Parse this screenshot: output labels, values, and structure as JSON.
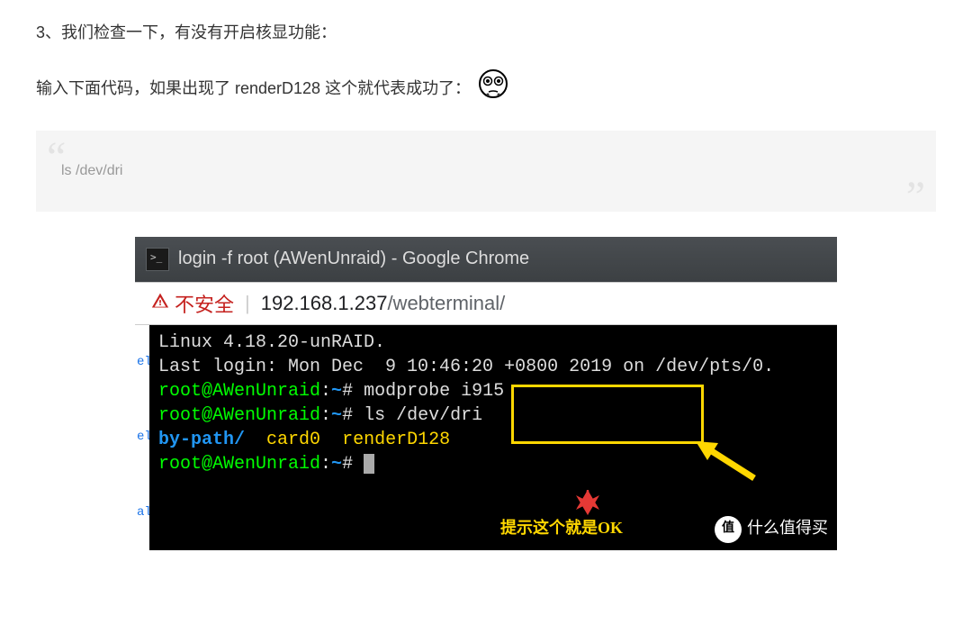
{
  "para1": "3、我们检查一下，有没有开启核显功能：",
  "para2": "输入下面代码，如果出现了 renderD128 这个就代表成功了：",
  "blockquote": "ls  /dev/dri",
  "window": {
    "title": "login -f root (AWenUnraid) - Google Chrome",
    "insecure_label": "不安全",
    "url_host": "192.168.1.237",
    "url_path": "/webterminal/"
  },
  "terminal": {
    "line1": "Linux 4.18.20-unRAID.",
    "line2": "Last login: Mon Dec  9 10:46:20 +0800 2019 on /dev/pts/0.",
    "prompt": "root@AWenUnraid",
    "sep": ":",
    "tilde": "~",
    "hash": "#",
    "cmd1": " modprobe i915",
    "cmd2": " ls /dev/dri",
    "out_bypath": "by-path/",
    "out_card0": "card0",
    "out_render": "renderD128",
    "left_frag1": "el",
    "left_frag2": "el",
    "left_frag3": "alt"
  },
  "annotation": "提示这个就是OK",
  "watermark": {
    "badge": "值",
    "text": "什么值得买"
  }
}
